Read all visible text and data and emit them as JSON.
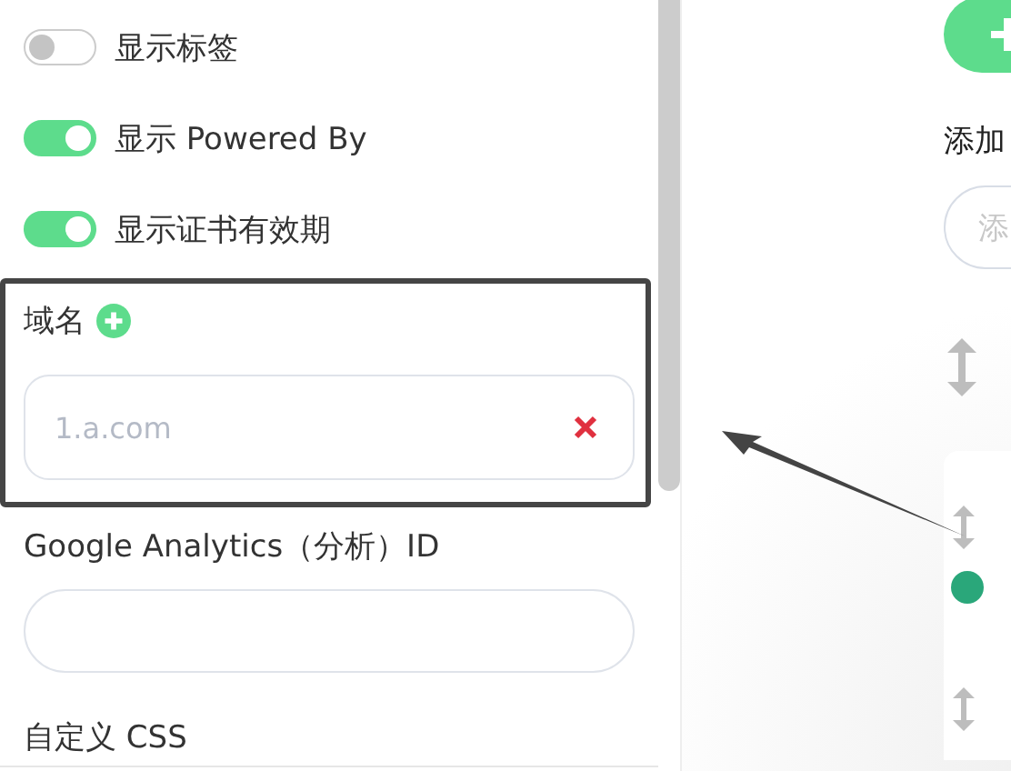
{
  "toggles": [
    {
      "label": "显示标签",
      "on": false
    },
    {
      "label": "显示 Powered By",
      "on": true
    },
    {
      "label": "显示证书有效期",
      "on": true
    }
  ],
  "domain": {
    "label": "域名",
    "placeholder": "1.a.com"
  },
  "analytics": {
    "label": "Google Analytics（分析）ID"
  },
  "custom_css": {
    "label": "自定义 CSS"
  },
  "right": {
    "add_label": "添加",
    "input_placeholder": "添"
  }
}
